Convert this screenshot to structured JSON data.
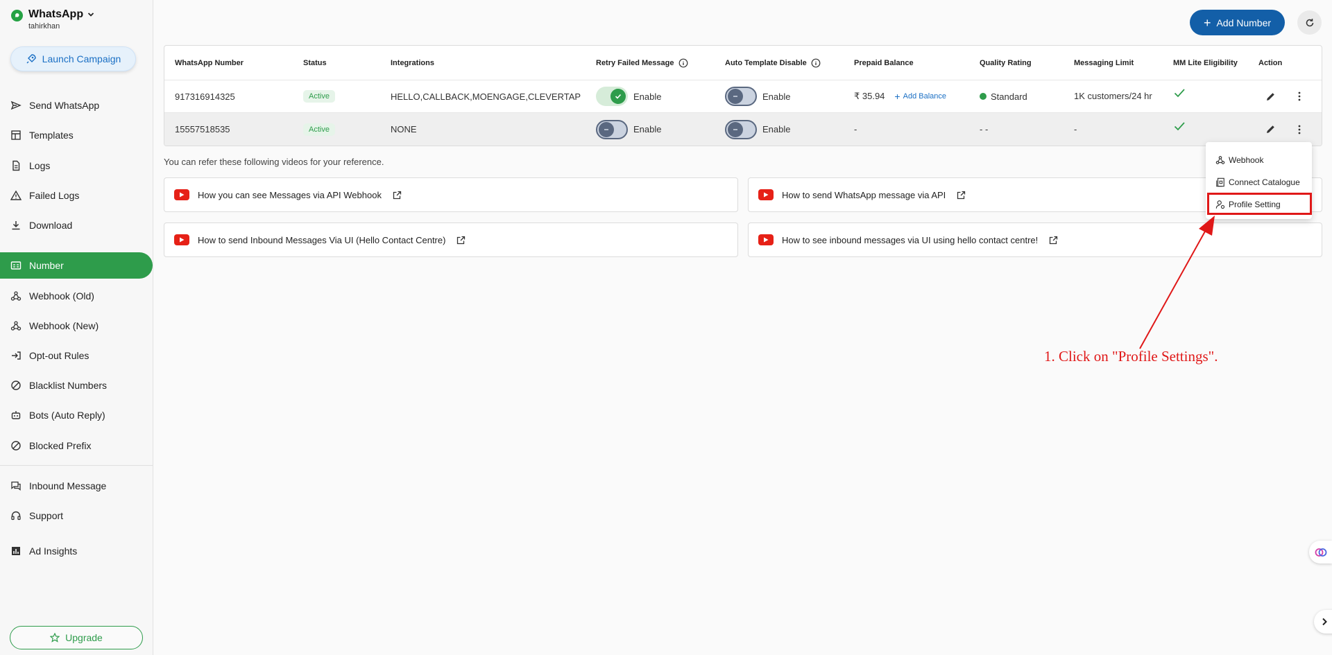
{
  "brand": {
    "name": "WhatsApp",
    "user": "tahirkhan"
  },
  "launch": {
    "label": "Launch Campaign"
  },
  "nav": {
    "items": [
      {
        "label": "Send WhatsApp"
      },
      {
        "label": "Templates"
      },
      {
        "label": "Logs"
      },
      {
        "label": "Failed Logs"
      },
      {
        "label": "Download"
      },
      {
        "label": "Number"
      },
      {
        "label": "Webhook (Old)"
      },
      {
        "label": "Webhook (New)"
      },
      {
        "label": "Opt-out Rules"
      },
      {
        "label": "Blacklist Numbers"
      },
      {
        "label": "Bots (Auto Reply)"
      },
      {
        "label": "Blocked Prefix"
      },
      {
        "label": "Inbound Message"
      },
      {
        "label": "Support"
      },
      {
        "label": "Ad Insights"
      }
    ]
  },
  "upgrade": {
    "label": "Upgrade"
  },
  "toolbar": {
    "add_number": "Add Number"
  },
  "table": {
    "headers": [
      "WhatsApp Number",
      "Status",
      "Integrations",
      "Retry Failed Message",
      "Auto Template Disable",
      "Prepaid Balance",
      "Quality Rating",
      "Messaging Limit",
      "MM Lite Eligibility",
      "Action"
    ],
    "rows": [
      {
        "number": "917316914325",
        "status": "Active",
        "integrations": "HELLO,CALLBACK,MOENGAGE,CLEVERTAP",
        "retry": "Enable",
        "retry_on": true,
        "auto": "Enable",
        "auto_on": false,
        "balance": "₹ 35.94",
        "add_balance": "Add Balance",
        "quality": "Standard",
        "limit": "1K customers/24 hr"
      },
      {
        "number": "15557518535",
        "status": "Active",
        "integrations": "NONE",
        "retry": "Enable",
        "retry_on": false,
        "auto": "Enable",
        "auto_on": false,
        "balance": "-",
        "quality": "- -",
        "limit": "-"
      }
    ]
  },
  "refer_text": "You can refer these following videos for your reference.",
  "videos": [
    {
      "title": "How you can see Messages via API Webhook"
    },
    {
      "title": "How to send WhatsApp message via API"
    },
    {
      "title": "How to send Inbound Messages Via UI (Hello Contact Centre)"
    },
    {
      "title": "How to see inbound messages via UI using hello contact centre!"
    }
  ],
  "menu": {
    "items": [
      {
        "label": "Webhook"
      },
      {
        "label": "Connect Catalogue"
      },
      {
        "label": "Profile Setting"
      }
    ]
  },
  "annotation": "1. Click on \"Profile Settings\".",
  "colors": {
    "accent_green": "#2e9c4b",
    "primary_blue": "#135fa8",
    "annotation_red": "#e01818"
  }
}
